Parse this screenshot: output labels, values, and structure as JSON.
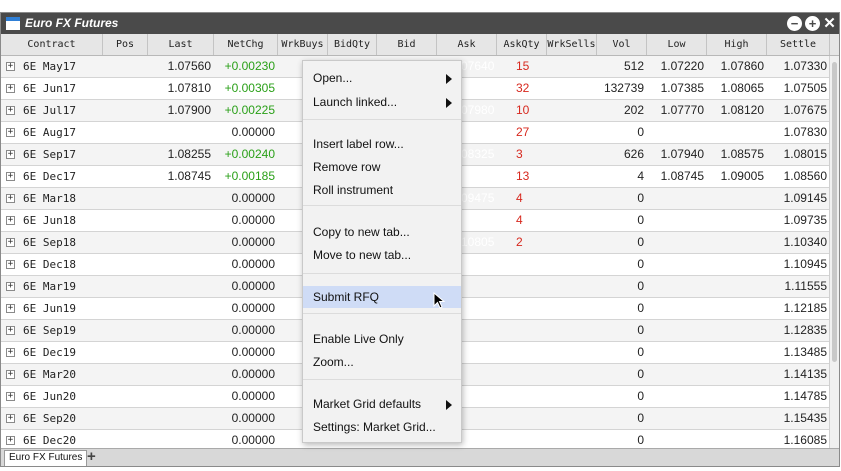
{
  "window": {
    "title": "Euro FX Futures",
    "buttons": [
      {
        "name": "minimize-button",
        "glyph": "−"
      },
      {
        "name": "add-button",
        "glyph": "+"
      },
      {
        "name": "close-button",
        "glyph": "✕"
      }
    ]
  },
  "columns": [
    {
      "key": "contract",
      "label": "Contract"
    },
    {
      "key": "pos",
      "label": "Pos"
    },
    {
      "key": "last",
      "label": "Last"
    },
    {
      "key": "netchg",
      "label": "NetChg"
    },
    {
      "key": "wrkbuys",
      "label": "WrkBuys"
    },
    {
      "key": "bidqty",
      "label": "BidQty"
    },
    {
      "key": "bid",
      "label": "Bid"
    },
    {
      "key": "ask",
      "label": "Ask"
    },
    {
      "key": "askqty",
      "label": "AskQty"
    },
    {
      "key": "wrksells",
      "label": "WrkSells"
    },
    {
      "key": "vol",
      "label": "Vol"
    },
    {
      "key": "low",
      "label": "Low"
    },
    {
      "key": "high",
      "label": "High"
    },
    {
      "key": "settle",
      "label": "Settle"
    }
  ],
  "rows": [
    {
      "contract": "6E May17",
      "last": "1.07560",
      "netchg": "+0.00230",
      "ask": "07640",
      "askqty": "15",
      "vol": "512",
      "low": "1.07220",
      "high": "1.07860",
      "settle": "1.07330"
    },
    {
      "contract": "6E Jun17",
      "last": "1.07810",
      "netchg": "+0.00305",
      "ask": "07810",
      "askqty": "32",
      "vol": "132739",
      "low": "1.07385",
      "high": "1.08065",
      "settle": "1.07505"
    },
    {
      "contract": "6E Jul17",
      "last": "1.07900",
      "netchg": "+0.00225",
      "ask": "07980",
      "askqty": "10",
      "vol": "202",
      "low": "1.07770",
      "high": "1.08120",
      "settle": "1.07675"
    },
    {
      "contract": "6E Aug17",
      "last": "",
      "netchg": "0.00000",
      "ask": "08160",
      "askqty": "27",
      "vol": "0",
      "low": "",
      "high": "",
      "settle": "1.07830"
    },
    {
      "contract": "6E Sep17",
      "last": "1.08255",
      "netchg": "+0.00240",
      "ask": "08325",
      "askqty": "3",
      "vol": "626",
      "low": "1.07940",
      "high": "1.08575",
      "settle": "1.08015"
    },
    {
      "contract": "6E Dec17",
      "last": "1.08745",
      "netchg": "+0.00185",
      "ask": "08880",
      "askqty": "13",
      "vol": "4",
      "low": "1.08745",
      "high": "1.09005",
      "settle": "1.08560"
    },
    {
      "contract": "6E Mar18",
      "last": "",
      "netchg": "0.00000",
      "ask": "09475",
      "askqty": "4",
      "vol": "0",
      "low": "",
      "high": "",
      "settle": "1.09145"
    },
    {
      "contract": "6E Jun18",
      "last": "",
      "netchg": "0.00000",
      "ask": "10080",
      "askqty": "4",
      "vol": "0",
      "low": "",
      "high": "",
      "settle": "1.09735"
    },
    {
      "contract": "6E Sep18",
      "last": "",
      "netchg": "0.00000",
      "ask": "10805",
      "askqty": "2",
      "vol": "0",
      "low": "",
      "high": "",
      "settle": "1.10340"
    },
    {
      "contract": "6E Dec18",
      "last": "",
      "netchg": "0.00000",
      "ask": "",
      "askqty": "",
      "vol": "0",
      "low": "",
      "high": "",
      "settle": "1.10945"
    },
    {
      "contract": "6E Mar19",
      "last": "",
      "netchg": "0.00000",
      "ask": "",
      "askqty": "",
      "vol": "0",
      "low": "",
      "high": "",
      "settle": "1.11555"
    },
    {
      "contract": "6E Jun19",
      "last": "",
      "netchg": "0.00000",
      "ask": "",
      "askqty": "",
      "vol": "0",
      "low": "",
      "high": "",
      "settle": "1.12185"
    },
    {
      "contract": "6E Sep19",
      "last": "",
      "netchg": "0.00000",
      "ask": "",
      "askqty": "",
      "vol": "0",
      "low": "",
      "high": "",
      "settle": "1.12835"
    },
    {
      "contract": "6E Dec19",
      "last": "",
      "netchg": "0.00000",
      "ask": "",
      "askqty": "",
      "vol": "0",
      "low": "",
      "high": "",
      "settle": "1.13485"
    },
    {
      "contract": "6E Mar20",
      "last": "",
      "netchg": "0.00000",
      "ask": "",
      "askqty": "",
      "vol": "0",
      "low": "",
      "high": "",
      "settle": "1.14135"
    },
    {
      "contract": "6E Jun20",
      "last": "",
      "netchg": "0.00000",
      "ask": "",
      "askqty": "",
      "vol": "0",
      "low": "",
      "high": "",
      "settle": "1.14785"
    },
    {
      "contract": "6E Sep20",
      "last": "",
      "netchg": "0.00000",
      "ask": "",
      "askqty": "",
      "vol": "0",
      "low": "",
      "high": "",
      "settle": "1.15435"
    },
    {
      "contract": "6E Dec20",
      "last": "",
      "netchg": "0.00000",
      "ask": "",
      "askqty": "",
      "vol": "0",
      "low": "",
      "high": "",
      "settle": "1.16085"
    }
  ],
  "context_menu": {
    "groups": [
      [
        {
          "label": "Open...",
          "submenu": true
        },
        {
          "label": "Launch linked...",
          "submenu": true
        }
      ],
      [
        {
          "label": "Insert label row..."
        },
        {
          "label": "Remove row"
        },
        {
          "label": "Roll instrument"
        }
      ],
      [
        {
          "label": "Copy to new tab..."
        },
        {
          "label": "Move to new tab..."
        }
      ],
      [
        {
          "label": "Submit RFQ",
          "highlighted": true
        }
      ],
      [
        {
          "label": "Enable Live Only"
        },
        {
          "label": "Zoom..."
        }
      ],
      [
        {
          "label": "Market Grid defaults",
          "submenu": true
        },
        {
          "label": "Settings: Market Grid..."
        }
      ]
    ]
  },
  "tabs": {
    "items": [
      {
        "label": "Euro FX Futures",
        "active": true
      }
    ],
    "add_label": "+"
  },
  "colors": {
    "titlebar": "#4a4a4a",
    "bid_accent": "#2b8ad6",
    "ask_column": "#d23a2a",
    "positive_change": "#2aa018",
    "ask_qty": "#d7281e",
    "menu_highlight": "#cfdcf6"
  }
}
